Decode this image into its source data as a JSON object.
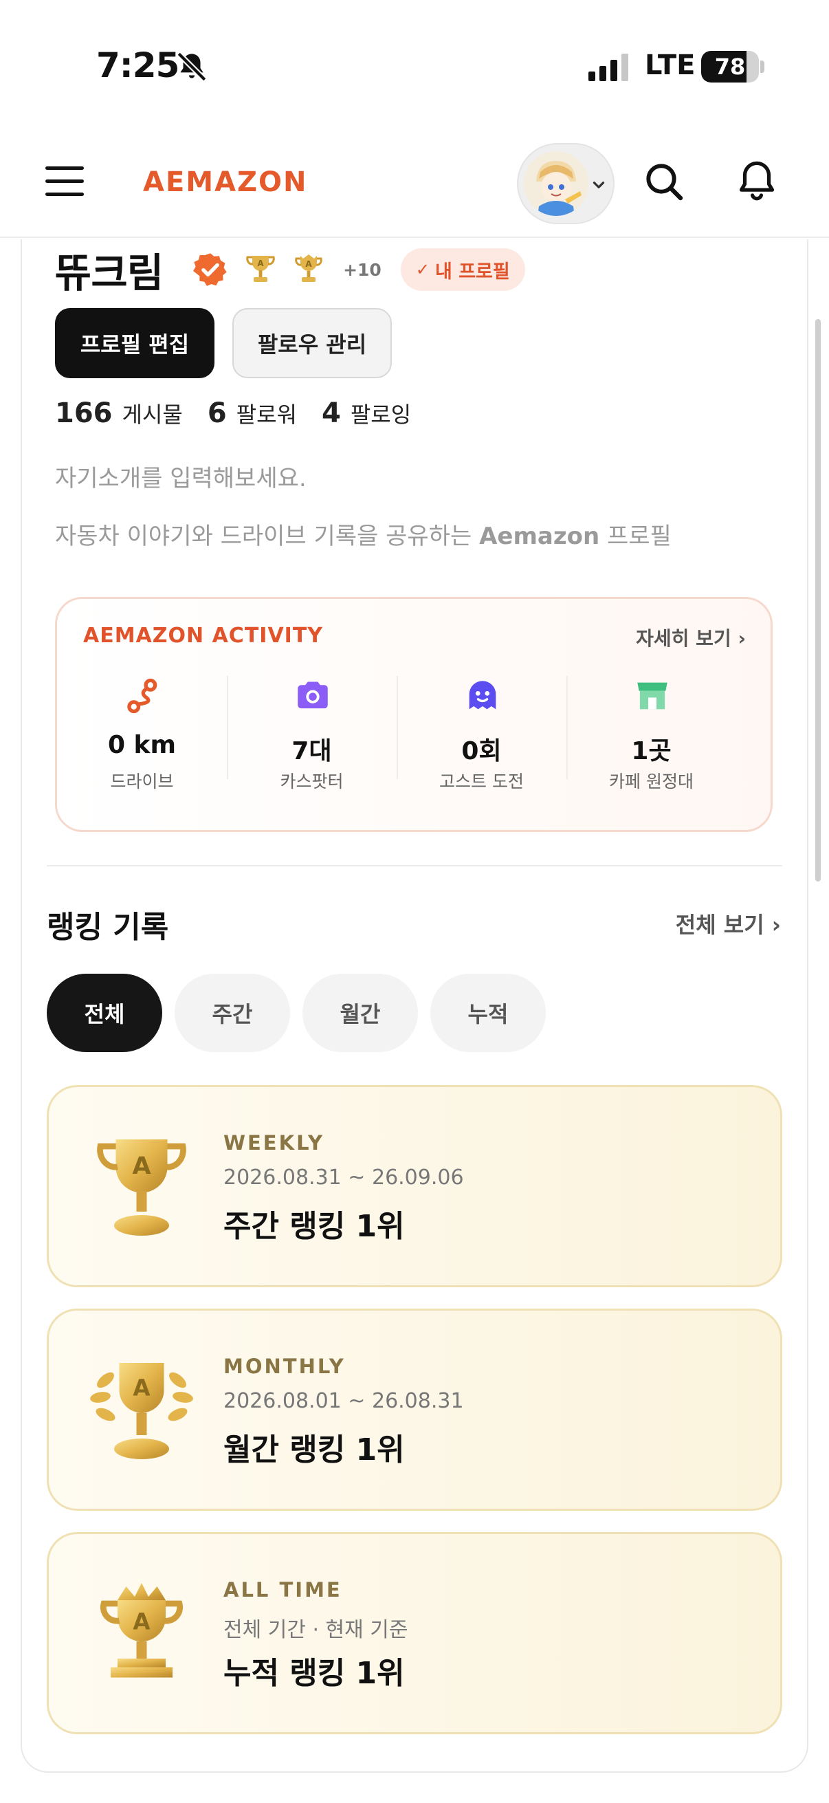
{
  "status_bar": {
    "time": "7:25",
    "network": "LTE",
    "battery": "78",
    "battery_level": 0.78
  },
  "header": {
    "logo": "AEMAZON",
    "icons": [
      "menu-icon",
      "avatar",
      "chevron-down-icon",
      "search-icon",
      "bell-icon"
    ]
  },
  "profile": {
    "name": "뜌크림",
    "more_badges": "+10",
    "my_profile_label": "내 프로필",
    "edit_button": "프로필 편집",
    "follow_button": "팔로우 관리",
    "stats": {
      "posts_count": "166",
      "posts_label": "게시물",
      "followers_count": "6",
      "followers_label": "팔로워",
      "following_count": "4",
      "following_label": "팔로잉"
    },
    "bio_placeholder": "자기소개를 입력해보세요.",
    "bio_prefix": "자동차 이야기와 드라이브 기록을 공유하는 ",
    "bio_brand": "Aemazon",
    "bio_suffix": " 프로필"
  },
  "activity": {
    "title": "AEMAZON ACTIVITY",
    "more": "자세히 보기 ›",
    "items": [
      {
        "value": "0 km",
        "label": "드라이브",
        "icon": "route-icon",
        "color": "#e55a2b"
      },
      {
        "value": "7대",
        "label": "카스팟터",
        "icon": "camera-icon",
        "color": "#8b5cf6"
      },
      {
        "value": "0회",
        "label": "고스트 도전",
        "icon": "ghost-icon",
        "color": "#5b4df0"
      },
      {
        "value": "1곳",
        "label": "카페 원정대",
        "icon": "store-icon",
        "color": "#3fbf7f"
      }
    ]
  },
  "ranking": {
    "title": "랭킹 기록",
    "view_all": "전체 보기 ›",
    "tabs": [
      "전체",
      "주간",
      "월간",
      "누적"
    ],
    "active_tab": 0,
    "cards": [
      {
        "period": "WEEKLY",
        "range": "2026.08.31 ~ 26.09.06",
        "place": "주간 랭킹 1위",
        "icon": "trophy-icon"
      },
      {
        "period": "MONTHLY",
        "range": "2026.08.01 ~ 26.08.31",
        "place": "월간 랭킹 1위",
        "icon": "laurel-trophy-icon"
      },
      {
        "period": "ALL TIME",
        "range": "전체 기간 · 현재 기준",
        "place": "누적 랭킹 1위",
        "icon": "crown-trophy-icon"
      }
    ]
  },
  "colors": {
    "accent": "#e55a2b",
    "gold": "#e3b44a",
    "badge_bg": "#fde9e2"
  }
}
